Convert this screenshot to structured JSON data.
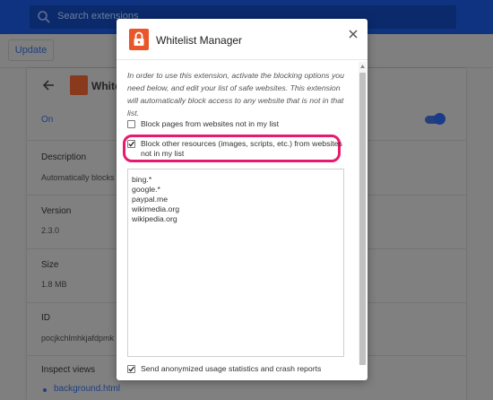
{
  "background": {
    "search_placeholder": "Search extensions",
    "update_label": "Update",
    "extension_title": "Whitel",
    "status": "On",
    "description_label": "Description",
    "description_value": "Automatically blocks",
    "version_label": "Version",
    "version_value": "2.3.0",
    "size_label": "Size",
    "size_value": "1.8 MB",
    "id_label": "ID",
    "id_value": "pocjkchlmhkjafdpmk",
    "inspect_label": "Inspect views",
    "inspect_link": "background.html"
  },
  "dialog": {
    "title": "Whitelist Manager",
    "intro": "In order to use this extension, activate the blocking options you need below, and edit your list of safe websites. This extension will automatically block access to any website that is not in that list.",
    "options": [
      {
        "label": "Block pages from websites not in my list",
        "checked": false
      },
      {
        "label": "Block other resources (images, scripts, etc.) from websites not in my list",
        "checked": true
      }
    ],
    "whitelist_text": "bing.*\ngoogle.*\npaypal.me\nwikimedia.org\nwikipedia.org",
    "stats_option": {
      "label": "Send anonymized usage statistics and crash reports",
      "checked": true
    }
  },
  "colors": {
    "accent_orange": "#e8562a",
    "highlight_pink": "#e8196e",
    "header_blue": "#0f3380"
  },
  "icons": {
    "search": "search-icon",
    "back": "back-arrow-icon",
    "close": "close-icon",
    "lock": "lock-icon"
  }
}
